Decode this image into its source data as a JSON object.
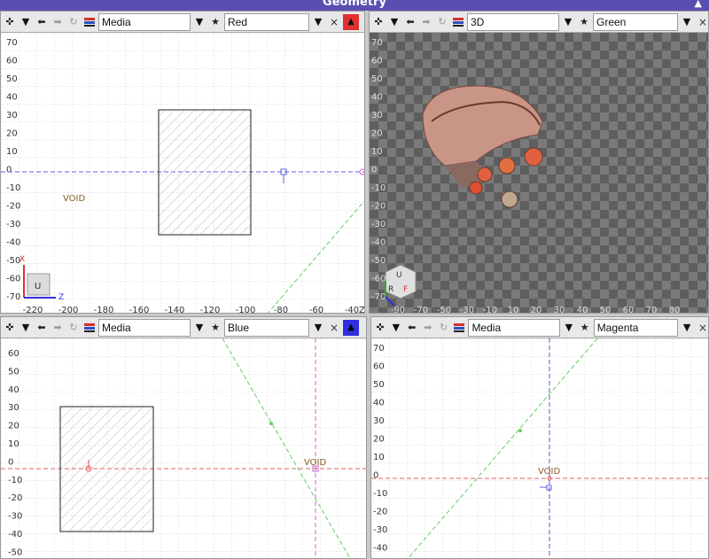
{
  "window": {
    "title": "Geometry",
    "corner_glyph": "▲"
  },
  "toolbar_glyphs": {
    "transform": "✜",
    "dropdown": "▼",
    "undo": "⬅",
    "redo": "➡",
    "reset": "↻",
    "star": "★",
    "close": "×",
    "flip": "▲"
  },
  "viewports": {
    "top_left": {
      "mode": "Media",
      "view": "Red",
      "accent": "#e03030",
      "void_label": "VOID",
      "y_ticks": [
        "70",
        "60",
        "50",
        "40",
        "30",
        "20",
        "10",
        "0",
        "-10",
        "-20",
        "-30",
        "-40",
        "-50",
        "-60",
        "-70"
      ],
      "x_ticks": [
        "-220",
        "-200",
        "-180",
        "-160",
        "-140",
        "-120",
        "-100",
        "-80",
        "-60",
        "-40"
      ],
      "axis_labels": {
        "x": "X",
        "z": "Z",
        "corner_z": "Z"
      },
      "widget_label": "U"
    },
    "top_right": {
      "mode": "3D",
      "view": "Green",
      "accent": "#30b030",
      "y_ticks": [
        "70",
        "60",
        "50",
        "40",
        "30",
        "20",
        "10",
        "0",
        "-10",
        "-20",
        "-30",
        "-40",
        "-50",
        "-60",
        "-70"
      ],
      "x_ticks": [
        "-90",
        "-70",
        "-50",
        "-30",
        "-10",
        "10",
        "20",
        "30",
        "40",
        "50",
        "60",
        "70",
        "80"
      ],
      "cube_labels": {
        "u": "U",
        "r": "R",
        "f": "F"
      }
    },
    "bottom_left": {
      "mode": "Media",
      "view": "Blue",
      "accent": "#3030e0",
      "void_label": "VOID",
      "y_ticks": [
        "60",
        "50",
        "40",
        "30",
        "20",
        "10",
        "0",
        "-10",
        "-20",
        "-30",
        "-40",
        "-50"
      ]
    },
    "bottom_right": {
      "mode": "Media",
      "view": "Magenta",
      "accent": "#d040d0",
      "void_label": "VOID",
      "y_ticks": [
        "70",
        "60",
        "50",
        "40",
        "30",
        "20",
        "10",
        "0",
        "-10",
        "-20",
        "-30",
        "-40"
      ]
    }
  }
}
